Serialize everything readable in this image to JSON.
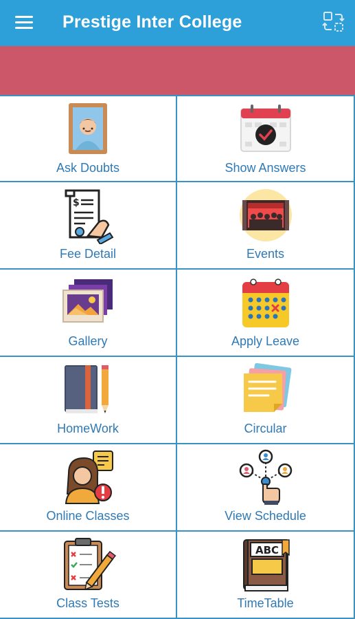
{
  "app": {
    "title": "Prestige Inter College"
  },
  "tiles": [
    {
      "label": "Ask Doubts",
      "icon": "student-portrait-icon"
    },
    {
      "label": "Show Answers",
      "icon": "calendar-check-icon"
    },
    {
      "label": "Fee Detail",
      "icon": "fee-receipt-icon"
    },
    {
      "label": "Events",
      "icon": "theater-stage-icon"
    },
    {
      "label": "Gallery",
      "icon": "photo-gallery-icon"
    },
    {
      "label": "Apply Leave",
      "icon": "leave-calendar-icon"
    },
    {
      "label": "HomeWork",
      "icon": "book-pencil-icon"
    },
    {
      "label": "Circular",
      "icon": "sticky-notes-icon"
    },
    {
      "label": "Online Classes",
      "icon": "online-teacher-icon"
    },
    {
      "label": "View Schedule",
      "icon": "network-touch-icon"
    },
    {
      "label": "Class Tests",
      "icon": "test-clipboard-icon"
    },
    {
      "label": "TimeTable",
      "icon": "abc-book-icon"
    }
  ],
  "colors": {
    "appbar": "#2d9fd9",
    "banner": "#cc5768",
    "grid_lines": "#3793c4",
    "label_text": "#2f79b5"
  }
}
